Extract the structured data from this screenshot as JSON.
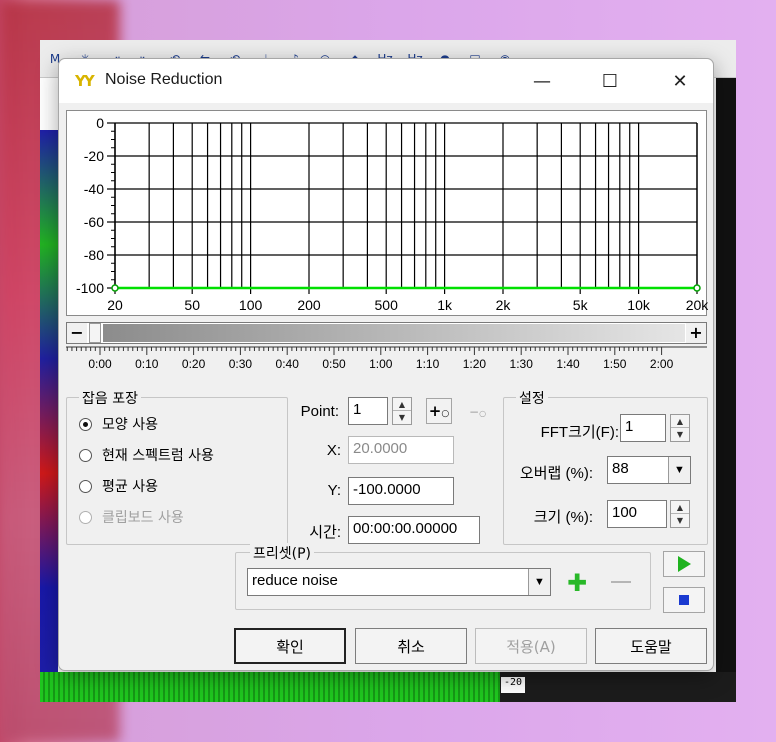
{
  "dialog": {
    "title": "Noise Reduction",
    "minimize_glyph": "—",
    "maximize_glyph": "☐",
    "close_glyph": "✕"
  },
  "graph": {
    "y_ticks": [
      "0",
      "-20",
      "-40",
      "-60",
      "-80",
      "-100"
    ],
    "x_ticks": [
      "20",
      "50",
      "100",
      "200",
      "500",
      "1k",
      "2k",
      "5k",
      "10k",
      "20k"
    ],
    "curve_color": "#00e000"
  },
  "timeline": {
    "minus": "−",
    "plus": "+",
    "labels": [
      "0:00",
      "0:10",
      "0:20",
      "0:30",
      "0:40",
      "0:50",
      "1:00",
      "1:10",
      "1:20",
      "1:30",
      "1:40",
      "1:50",
      "2:00"
    ]
  },
  "noise_profile": {
    "legend": "잡음 포장",
    "options": [
      {
        "label": "모양 사용",
        "checked": true,
        "enabled": true
      },
      {
        "label": "현재 스펙트럼 사용",
        "checked": false,
        "enabled": true
      },
      {
        "label": "평균 사용",
        "checked": false,
        "enabled": true
      },
      {
        "label": "클립보드 사용",
        "checked": false,
        "enabled": false
      }
    ]
  },
  "point": {
    "point_label": "Point:",
    "point_value": "1",
    "x_label": "X:",
    "x_value": "20.0000",
    "y_label": "Y:",
    "y_value": "-100.0000",
    "time_label": "시간:",
    "time_value": "00:00:00.00000"
  },
  "settings": {
    "legend": "설정",
    "fft_label": "FFT크기(F):",
    "fft_value": "1",
    "overlap_label": "오버랩 (%):",
    "overlap_value": "88",
    "size_label": "크기 (%):",
    "size_value": "100"
  },
  "preset": {
    "legend": "프리셋(P)",
    "value": "reduce noise"
  },
  "buttons": {
    "ok": "확인",
    "cancel": "취소",
    "apply": "적용(A)",
    "help": "도움말"
  },
  "background_app": {
    "toolbar_icons": [
      "M",
      "✳",
      "⇥",
      "⇤",
      "⟲",
      "⇆",
      "⟲",
      "♩",
      "♪",
      "◎",
      "◆",
      "Hz",
      "Hz",
      "●",
      "□",
      "◉"
    ],
    "ruler_value": "-20"
  }
}
